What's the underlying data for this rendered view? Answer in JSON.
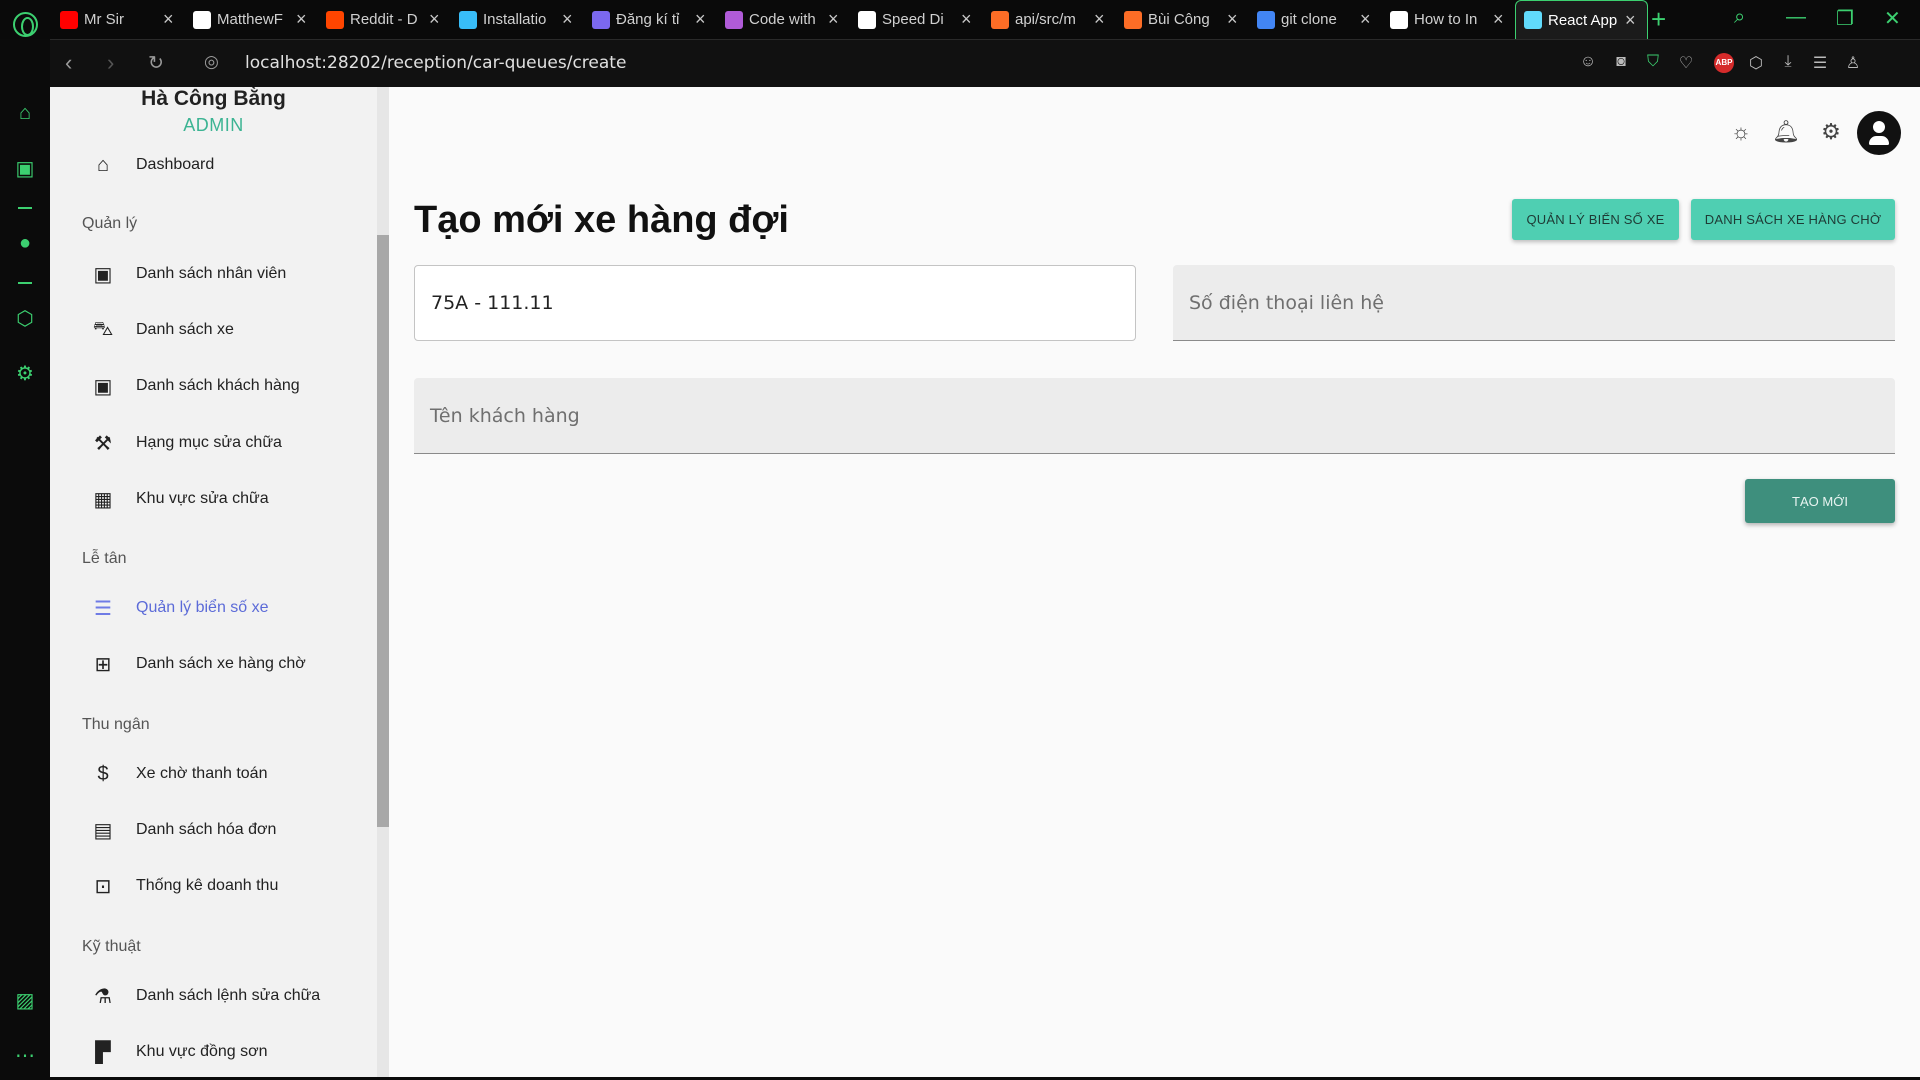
{
  "browser": {
    "tabs": [
      {
        "title": "Mr Sir",
        "favicon_color": "#ff0000"
      },
      {
        "title": "MatthewF",
        "favicon_color": "#ffffff"
      },
      {
        "title": "Reddit - D",
        "favicon_color": "#ff4500"
      },
      {
        "title": "Installatio",
        "favicon_color": "#38bdf8"
      },
      {
        "title": "Đăng kí tỉ",
        "favicon_color": "#7b68ee"
      },
      {
        "title": "Code with",
        "favicon_color": "#b05bd8"
      },
      {
        "title": "Speed Di",
        "favicon_color": "#ffffff"
      },
      {
        "title": "api/src/m",
        "favicon_color": "#fc6d26"
      },
      {
        "title": "Bùi Công",
        "favicon_color": "#fc6d26"
      },
      {
        "title": "git clone",
        "favicon_color": "#4285f4"
      },
      {
        "title": "How to In",
        "favicon_color": "#ffffff"
      },
      {
        "title": "React App",
        "favicon_color": "#61dafb"
      }
    ],
    "url": "localhost:28202/reception/car-queues/create",
    "accent": "#3cd070"
  },
  "sidebar": {
    "user_name": "Hà Công Bằng",
    "role": "ADMIN",
    "dashboard": "Dashboard",
    "sections": {
      "manage": "Quản lý",
      "reception": "Lễ tân",
      "cashier": "Thu ngân",
      "technical": "Kỹ thuật"
    },
    "items": {
      "employees": "Danh sách nhân viên",
      "cars": "Danh sách xe",
      "customers": "Danh sách khách hàng",
      "repair_categories": "Hạng mục sửa chữa",
      "repair_areas": "Khu vực sửa chữa",
      "plates": "Quản lý biển số xe",
      "queue": "Danh sách xe hàng chờ",
      "awaiting_payment": "Xe chờ thanh toán",
      "invoices": "Danh sách hóa đơn",
      "revenue": "Thống kê doanh thu",
      "repair_orders": "Danh sách lệnh sửa chữa",
      "paint_area": "Khu vực đồng sơn"
    },
    "active_color": "#5c6bd8"
  },
  "main": {
    "title": "Tạo mới xe hàng đợi",
    "btn_manage_plates": "QUẢN LÝ BIỂN SỐ XE",
    "btn_queue_list": "DANH SÁCH XE HÀNG CHỜ",
    "plate_value": "75A - 111.11",
    "phone_placeholder": "Số điện thoại liên hệ",
    "name_placeholder": "Tên khách hàng",
    "create_button": "TẠO MỚI",
    "accent": "#4fcfb2",
    "create_color": "#3e8f7d"
  }
}
